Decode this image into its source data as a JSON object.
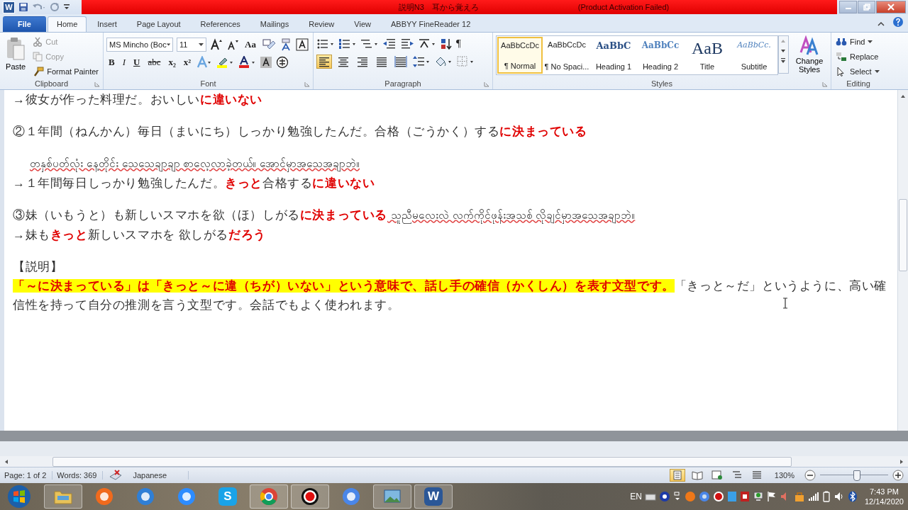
{
  "window": {
    "app_letter": "W",
    "title": "説明N3　耳から覚えろ",
    "title_status": "(Product Activation Failed)"
  },
  "tabs": [
    {
      "label": "File",
      "kind": "file",
      "selected": false
    },
    {
      "label": "Home",
      "kind": "tab",
      "selected": true
    },
    {
      "label": "Insert",
      "kind": "tab",
      "selected": false
    },
    {
      "label": "Page Layout",
      "kind": "tab",
      "selected": false
    },
    {
      "label": "References",
      "kind": "tab",
      "selected": false
    },
    {
      "label": "Mailings",
      "kind": "tab",
      "selected": false
    },
    {
      "label": "Review",
      "kind": "tab",
      "selected": false
    },
    {
      "label": "View",
      "kind": "tab",
      "selected": false
    },
    {
      "label": "ABBYY FineReader 12",
      "kind": "tab",
      "selected": false
    }
  ],
  "clipboard": {
    "label": "Clipboard",
    "paste": "Paste",
    "items": [
      {
        "label": "Cut",
        "kind": "cut",
        "disabled": true
      },
      {
        "label": "Copy",
        "kind": "copy",
        "disabled": true
      },
      {
        "label": "Format Painter",
        "kind": "painter",
        "disabled": false
      }
    ]
  },
  "font": {
    "label": "Font",
    "font_name": "MS Mincho (Boc",
    "font_size": "11",
    "change_case": "Aa",
    "format_buttons": [
      {
        "label": "B",
        "kind": "bold"
      },
      {
        "label": "I",
        "kind": "italic"
      },
      {
        "label": "U",
        "kind": "underline"
      },
      {
        "label": "abc",
        "kind": "strike"
      },
      {
        "label": "x₂",
        "kind": "subscript"
      },
      {
        "label": "x²",
        "kind": "superscript"
      }
    ]
  },
  "paragraph": {
    "label": "Paragraph",
    "pilcrow": "¶",
    "align_buttons": [
      {
        "kind": "left",
        "selected": true
      },
      {
        "kind": "center",
        "selected": false
      },
      {
        "kind": "right",
        "selected": false
      },
      {
        "kind": "justify",
        "selected": false
      },
      {
        "kind": "distributed",
        "selected": false
      }
    ]
  },
  "styles": {
    "label": "Styles",
    "change_styles": "Change Styles",
    "items": [
      {
        "preview": "AaBbCcDc",
        "label": "¶ Normal",
        "kind": "normal",
        "selected": true
      },
      {
        "preview": "AaBbCcDc",
        "label": "¶ No Spaci...",
        "kind": "nospacing",
        "selected": false
      },
      {
        "preview": "AaBbC",
        "label": "Heading 1",
        "kind": "heading1",
        "selected": false
      },
      {
        "preview": "AaBbCc",
        "label": "Heading 2",
        "kind": "heading2",
        "selected": false
      },
      {
        "preview": "AaB",
        "label": "Title",
        "kind": "title",
        "selected": false
      },
      {
        "preview": "AaBbCc.",
        "label": "Subtitle",
        "kind": "subtitle",
        "selected": false
      }
    ]
  },
  "editing": {
    "label": "Editing",
    "items": [
      {
        "label": "Find",
        "kind": "find"
      },
      {
        "label": "Replace",
        "kind": "replace"
      },
      {
        "label": "Select",
        "kind": "select"
      }
    ]
  },
  "document": {
    "blocks": [
      {
        "lines": [
          {
            "indented": false,
            "runs": [
              {
                "text": "→彼女が作った料理だ。おいしい",
                "kind": "plain"
              },
              {
                "text": "に違いない",
                "kind": "red"
              }
            ]
          }
        ]
      },
      {
        "lines": [
          {
            "indented": false,
            "runs": [
              {
                "text": "②１年間（ねんかん）毎日（まいにち）しっかり勉強したんだ。合格（ごうかく）する",
                "kind": "plain"
              },
              {
                "text": "に決まっている",
                "kind": "red"
              }
            ]
          }
        ]
      },
      {
        "lines": [
          {
            "indented": true,
            "runs": [
              {
                "text": "တနှစ်ပတ်လုံး နေ့တိုင်း သေသေချာချာ စာလေ့လာခဲ့တယ်။ အောင်မှာအသေအချာဘဲ။",
                "kind": "myanmar"
              }
            ]
          },
          {
            "indented": false,
            "runs": [
              {
                "text": "→１年間毎日しっかり勉強したんだ。",
                "kind": "plain"
              },
              {
                "text": "きっと",
                "kind": "red"
              },
              {
                "text": "合格する",
                "kind": "plain"
              },
              {
                "text": "に違いない",
                "kind": "red"
              }
            ]
          }
        ]
      },
      {
        "lines": [
          {
            "indented": false,
            "runs": [
              {
                "text": "③妹（いもうと）も新しいスマホを欲（ほ）しがる",
                "kind": "plain"
              },
              {
                "text": "に決まっている",
                "kind": "red"
              },
              {
                "text": " သူညီမလေးလဲ လက်ကိုင်ဖုန်းအသစ် လိုချင်မှာအသေအချာဘဲ။",
                "kind": "myanmar"
              }
            ]
          },
          {
            "indented": false,
            "runs": [
              {
                "text": "→妹も",
                "kind": "plain"
              },
              {
                "text": "きっと",
                "kind": "red"
              },
              {
                "text": "新しいスマホを 欲しがる",
                "kind": "plain"
              },
              {
                "text": "だろう",
                "kind": "red"
              }
            ]
          }
        ]
      },
      {
        "lines": [
          {
            "indented": false,
            "runs": [
              {
                "text": "【説明】",
                "kind": "plain"
              }
            ]
          },
          {
            "indented": false,
            "runs": [
              {
                "text": "「～に決まっている」は「きっと～に違（ちが）いない」という意味で、話し手の確信（かくしん）を表す文型です。",
                "kind": "highlight"
              },
              {
                "text": "「きっと～だ」というように、高い確信性を持って自分の推測を言う文型です。会話でもよく使われます。",
                "kind": "plain"
              }
            ]
          }
        ]
      }
    ]
  },
  "status_bar": {
    "page": "Page: 1 of 2",
    "words": "Words: 369",
    "language": "Japanese",
    "views": [
      {
        "kind": "print",
        "selected": true
      },
      {
        "kind": "reading",
        "selected": false
      },
      {
        "kind": "web",
        "selected": false
      },
      {
        "kind": "outline",
        "selected": false
      },
      {
        "kind": "draft",
        "selected": false
      }
    ],
    "zoom": {
      "reading": "130%",
      "level": 0.53
    }
  },
  "taskbar": {
    "apps": [
      {
        "kind": "folder",
        "open": true
      },
      {
        "kind": "firefox",
        "open": false
      },
      {
        "kind": "ie",
        "open": false
      },
      {
        "kind": "zoom",
        "open": false
      },
      {
        "kind": "skype",
        "open": false,
        "glyph": "S"
      },
      {
        "kind": "chrome",
        "open": true
      },
      {
        "kind": "recorder",
        "open": true
      },
      {
        "kind": "chromium",
        "open": false
      },
      {
        "kind": "photos",
        "open": true
      },
      {
        "kind": "word",
        "open": true,
        "glyph": "W"
      }
    ],
    "language": "EN",
    "time": "7:43 PM",
    "date": "12/14/2020"
  }
}
